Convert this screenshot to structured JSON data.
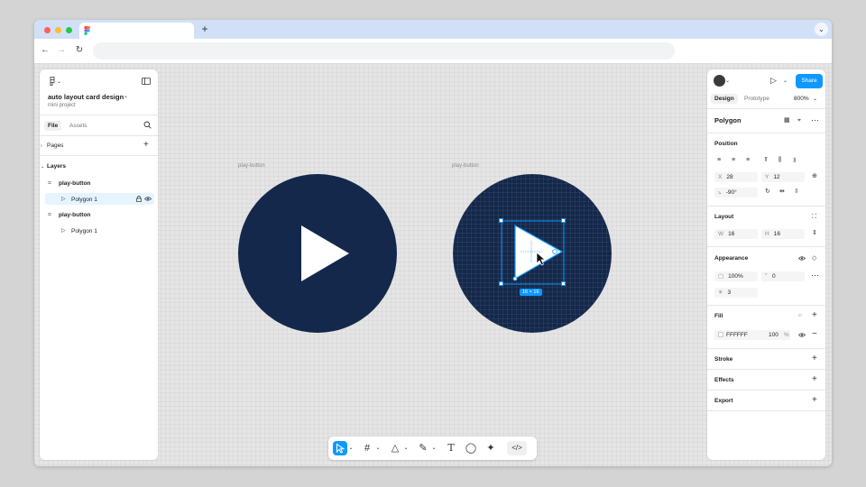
{
  "browser": {
    "new_tab": "+",
    "tab_menu": "⌄",
    "back": "←",
    "forward": "→",
    "reload": "↻"
  },
  "left_panel": {
    "file_name": "auto layout card design",
    "file_chevron": "⌄",
    "project": "mini project",
    "tabs": [
      "File",
      "Assets"
    ],
    "pages_label": "Pages",
    "pages_add": "+",
    "layers_label": "Layers",
    "layers": [
      {
        "name": "play-button",
        "kind": "frame"
      },
      {
        "name": "Polygon 1",
        "kind": "polygon",
        "selected": true
      },
      {
        "name": "play-button",
        "kind": "frame"
      },
      {
        "name": "Polygon 1",
        "kind": "polygon",
        "selected": false
      }
    ]
  },
  "canvas": {
    "frame_labels": [
      "play-button",
      "play-button"
    ],
    "size_badge": "16 × 16"
  },
  "right_panel": {
    "share_label": "Share",
    "tabs": [
      "Design",
      "Prototype"
    ],
    "zoom": "800%",
    "selection_name": "Polygon",
    "position_label": "Position",
    "x_label": "X",
    "x_value": "28",
    "y_label": "Y",
    "y_value": "12",
    "rotation_label": "⦣",
    "rotation_value": "-90°",
    "layout_label": "Layout",
    "w_label": "W",
    "w_value": "16",
    "h_label": "H",
    "h_value": "16",
    "appearance_label": "Appearance",
    "opacity_value": "100%",
    "radius_value": "0",
    "count_value": "3",
    "fill_label": "Fill",
    "fill_hex": "FFFFFF",
    "fill_opacity": "100",
    "fill_pct": "%",
    "stroke_label": "Stroke",
    "effects_label": "Effects",
    "export_label": "Export"
  },
  "colors": {
    "accent": "#0d99ff",
    "circle": "#14284b",
    "selected_layer": "#e5f4ff"
  },
  "icons": [
    "figma-logo",
    "sidebar-toggle-icon",
    "search-icon",
    "eye-icon",
    "lock-icon",
    "play-icon",
    "move-tool-icon",
    "frame-tool-icon",
    "shape-tool-icon",
    "pen-tool-icon",
    "text-tool-icon",
    "comment-tool-icon",
    "actions-tool-icon",
    "dev-mode-icon"
  ]
}
